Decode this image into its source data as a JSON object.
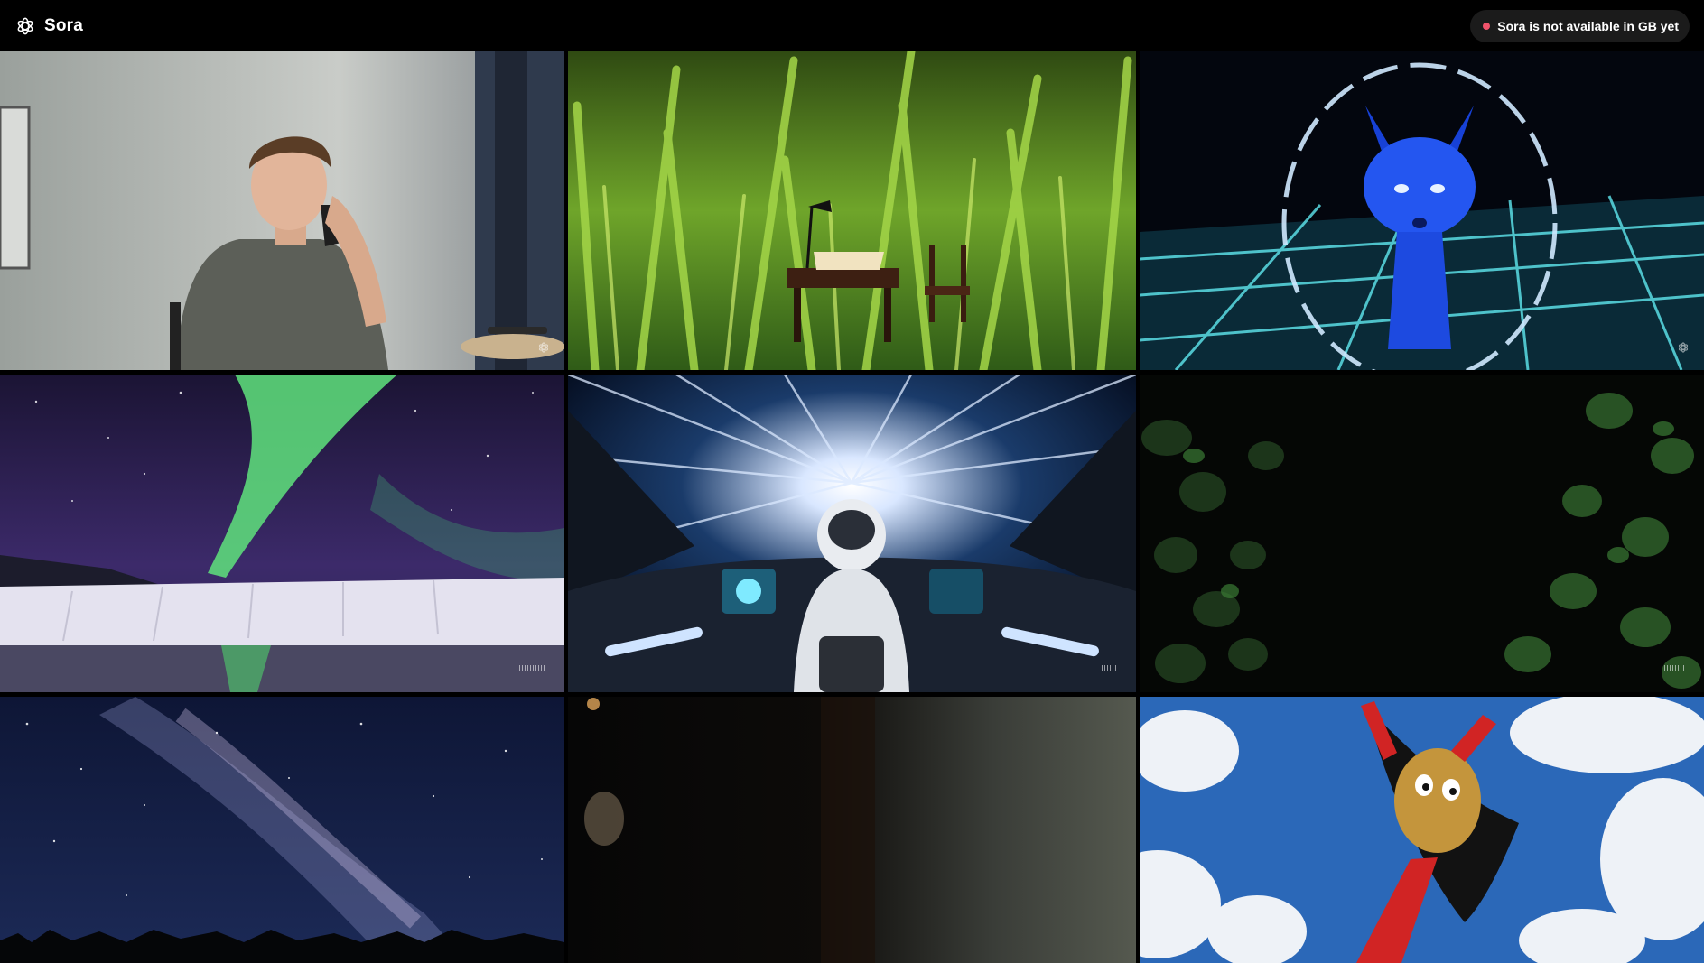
{
  "header": {
    "app_name": "Sora",
    "logo_icon": "openai-logo-icon",
    "availability_text": "Sora is not available in GB yet",
    "availability_dot_color": "#f0536b"
  },
  "colors": {
    "background": "#000000",
    "pill_background": "#1b1b1b"
  },
  "gallery": {
    "tiles": [
      {
        "subject": "man-on-phone"
      },
      {
        "subject": "tiny-desk-in-grass"
      },
      {
        "subject": "glowing-blue-fox"
      },
      {
        "subject": "aurora-over-glacier"
      },
      {
        "subject": "astronaut-in-hyperspace-cockpit"
      },
      {
        "subject": "dark-ivy-leaves"
      },
      {
        "subject": "milky-way-night-sky"
      },
      {
        "subject": "dark-blurred-interior"
      },
      {
        "subject": "superhero-potato-in-sky"
      }
    ]
  }
}
